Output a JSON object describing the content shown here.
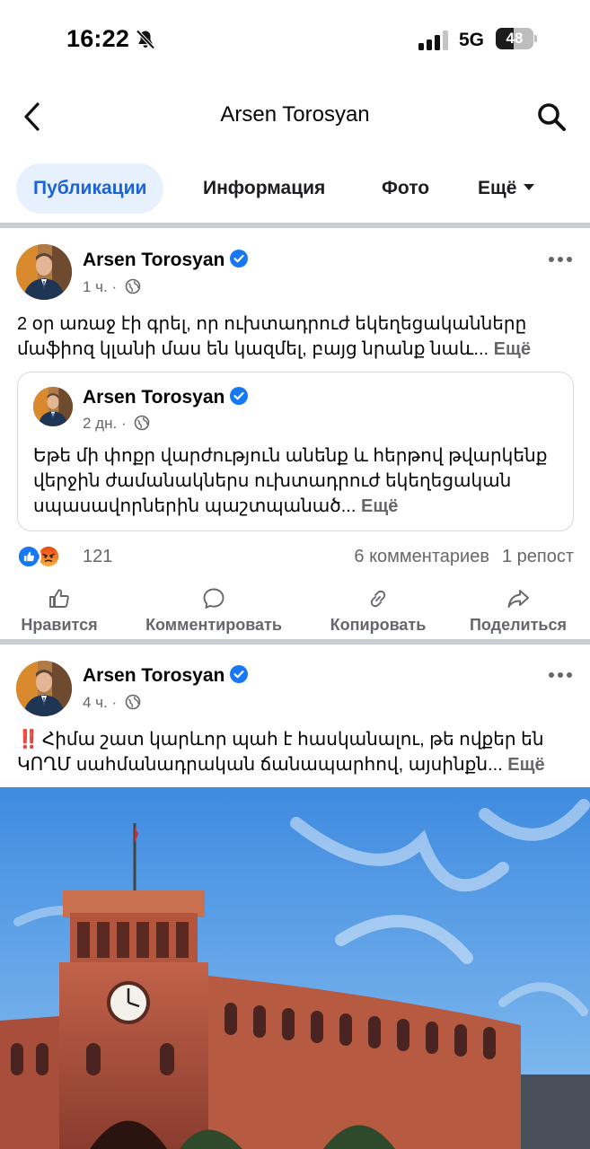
{
  "status_bar": {
    "time": "16:22",
    "network": "5G",
    "battery": "48",
    "battery_level": 0.48
  },
  "header": {
    "title": "Arsen Torosyan"
  },
  "tabs": [
    {
      "label": "Публикации",
      "active": true
    },
    {
      "label": "Информация",
      "active": false
    },
    {
      "label": "Фото",
      "active": false
    },
    {
      "label": "Ещё",
      "active": false
    }
  ],
  "posts": [
    {
      "author": "Arsen Torosyan",
      "time": "1 ч.",
      "text": "2 օր առաջ էի գրել, որ ուխտադրուժ եկեղեցականները մաֆիոզ կլանի մաս են կազմել, բայց նրանք նաև...",
      "more": "Ещё",
      "shared": {
        "author": "Arsen Torosyan",
        "time": "2 дн.",
        "text": "Եթե մի փոքր վարժություն անենք և հերթով թվարկենք վերջին ժամանակներս ուխտադրուժ եկեղեցական սպասավորներին պաշտպանած...",
        "more": "Ещё"
      },
      "reaction_count": "121",
      "comments": "6 комментариев",
      "reposts": "1 репост",
      "actions": {
        "like": "Нравится",
        "comment": "Комментировать",
        "copy": "Копировать",
        "share": "Поделиться"
      }
    },
    {
      "author": "Arsen Torosyan",
      "time": "4 ч.",
      "alert": "‼️",
      "text": "Հիմա շատ կարևոր պահ է հասկանալու, թե ովքեր են ԿՈՂՄ սահմանադրական ճանապարհով, այսինքն...",
      "more": "Ещё"
    }
  ],
  "colors": {
    "accent": "#1b64d8",
    "tab_active_bg": "#e7f0fd",
    "secondary_text": "#65676b",
    "separator": "#c9ccd1",
    "like_blue": "#1877f2",
    "angry_orange": "#f7714c"
  },
  "icons": [
    "bell-off-icon",
    "signal-icon",
    "back-icon",
    "search-icon",
    "verified-icon",
    "globe-icon",
    "more-dots-icon",
    "like-reaction-icon",
    "angry-reaction-icon",
    "thumbs-up-icon",
    "comment-icon",
    "link-icon",
    "share-icon"
  ]
}
